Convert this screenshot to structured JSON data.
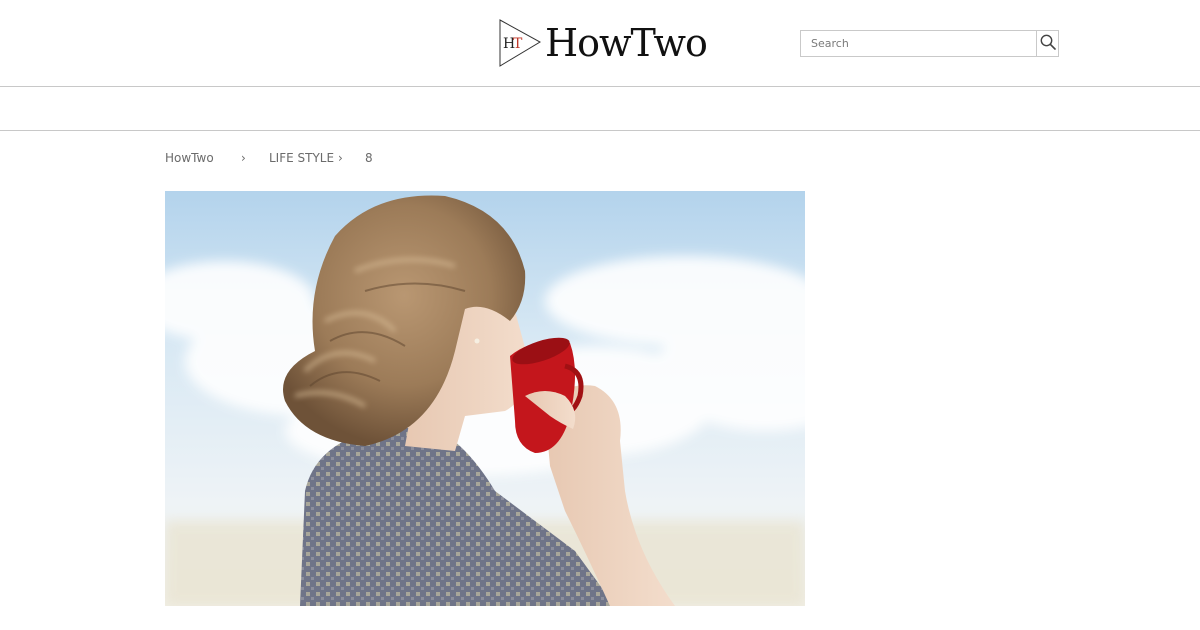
{
  "site": {
    "logo_mark": "HT",
    "logo_text": "HowTwo"
  },
  "search": {
    "placeholder": "Search",
    "value": "",
    "icon": "search-icon"
  },
  "breadcrumb": {
    "items": [
      "HowTwo",
      "LIFE STYLE",
      "8"
    ],
    "separator": "›"
  },
  "hero": {
    "image": "woman-drinking-from-red-cup-photo"
  },
  "colors": {
    "border": "#c8c8c8",
    "text_muted": "#6b6b6b",
    "logo_red": "#c0392b",
    "cup_red": "#c4161c"
  }
}
